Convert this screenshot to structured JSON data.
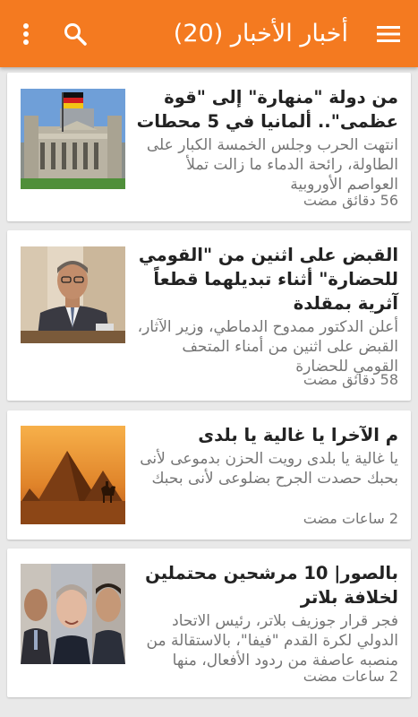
{
  "appbar": {
    "title": "أخبار الأخبار (20)",
    "menu_icon": "menu-icon",
    "search_icon": "search-icon",
    "more_icon": "more-vert-icon",
    "color": "#f47a20"
  },
  "articles": [
    {
      "headline": "من دولة \"منهارة\" إلى \"قوة عظمى\".. ألمانيا في 5 محطات",
      "summary": "انتهت الحرب وجلس الخمسة الكبار على الطاولة، رائحة الدماء ما زالت تملأ العواصم الأوروبية",
      "time": "56 دقائق مضت",
      "image": "reichstag-building-photo"
    },
    {
      "headline": "القبض على اثنين من \"القومي للحضارة\" أثناء تبديلهما قطعاً آثرية بمقلدة",
      "summary": "أعلن الدكتور ممدوح الدماطي، وزير الآثار، القبض على اثنين من أمناء المتحف القومي للحضارة",
      "time": "58 دقائق مضت",
      "image": "minister-portrait-photo"
    },
    {
      "headline": "م الآخرا يا غالية يا بلدى",
      "summary": "يا غالية يا بلدى رويت الحزن بدموعى لأنى بحبك حصدت الجرح بضلوعى لأنى بحبك",
      "time": "2 ساعات مضت",
      "image": "pyramids-sunset-photo"
    },
    {
      "headline": "بالصور| 10 مرشحين محتملين لخلافة بلاتر",
      "summary": "فجر قرار جوزيف بلاتر، رئيس الاتحاد الدولي لكرة القدم \"فيفا\"، بالاستقالة من منصبه عاصفة من ردود الأفعال، منها",
      "time": "2 ساعات مضت",
      "image": "candidates-faces-photo"
    }
  ]
}
